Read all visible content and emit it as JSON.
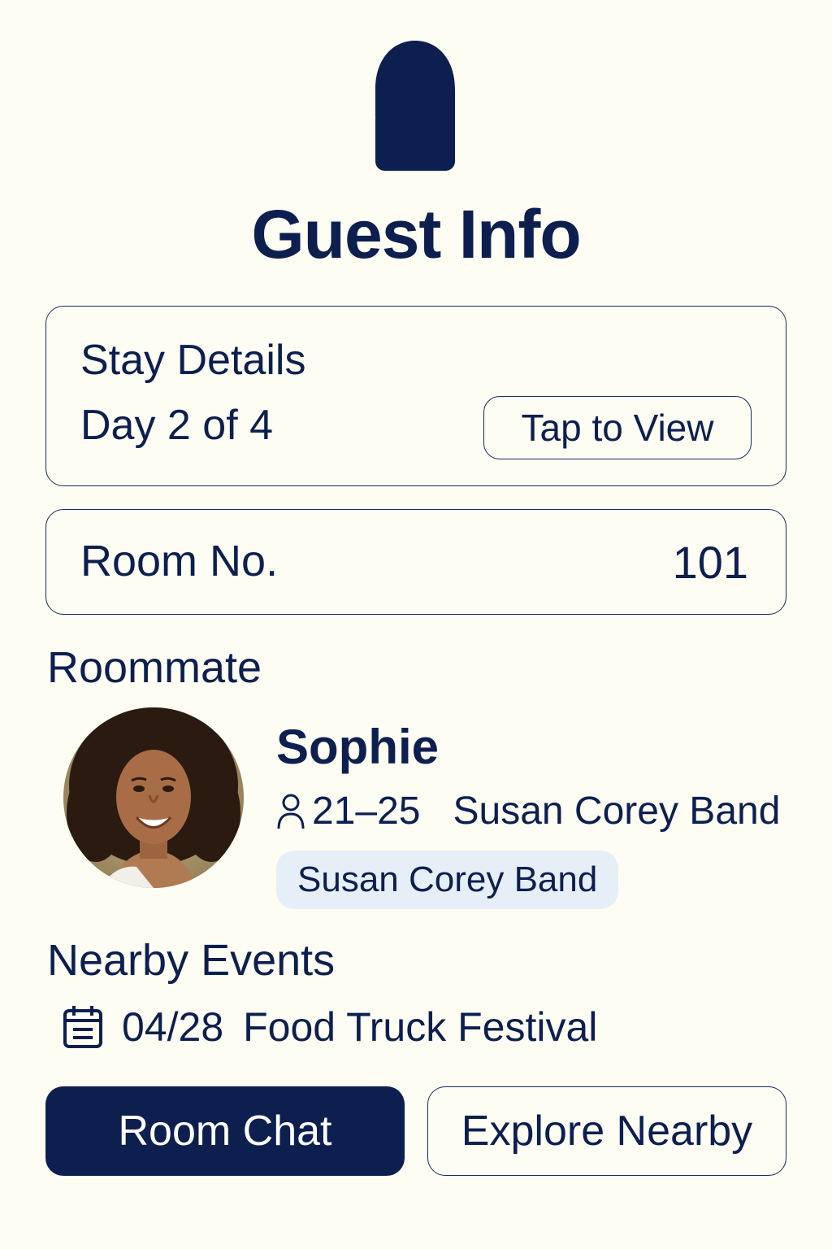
{
  "header": {
    "icon": "door-hanger-icon",
    "title": "Guest Info"
  },
  "stay": {
    "title": "Stay Details",
    "day_text": "Day 2 of 4",
    "view_button": "Tap to View"
  },
  "room": {
    "label": "Room No.",
    "number": "101"
  },
  "roommate": {
    "section_title": "Roommate",
    "name": "Sophie",
    "age_icon": "person-icon",
    "age_range": "21–25",
    "band": "Susan Corey Band",
    "tag": "Susan Corey Band"
  },
  "events": {
    "section_title": "Nearby Events",
    "items": [
      {
        "icon": "calendar-icon",
        "date": "04/28",
        "name": "Food Truck Festival"
      }
    ]
  },
  "actions": {
    "primary": "Room Chat",
    "secondary": "Explore Nearby"
  },
  "colors": {
    "background": "#fdfdf4",
    "navy": "#0d1f4f",
    "tag_background": "#e6eff7"
  }
}
